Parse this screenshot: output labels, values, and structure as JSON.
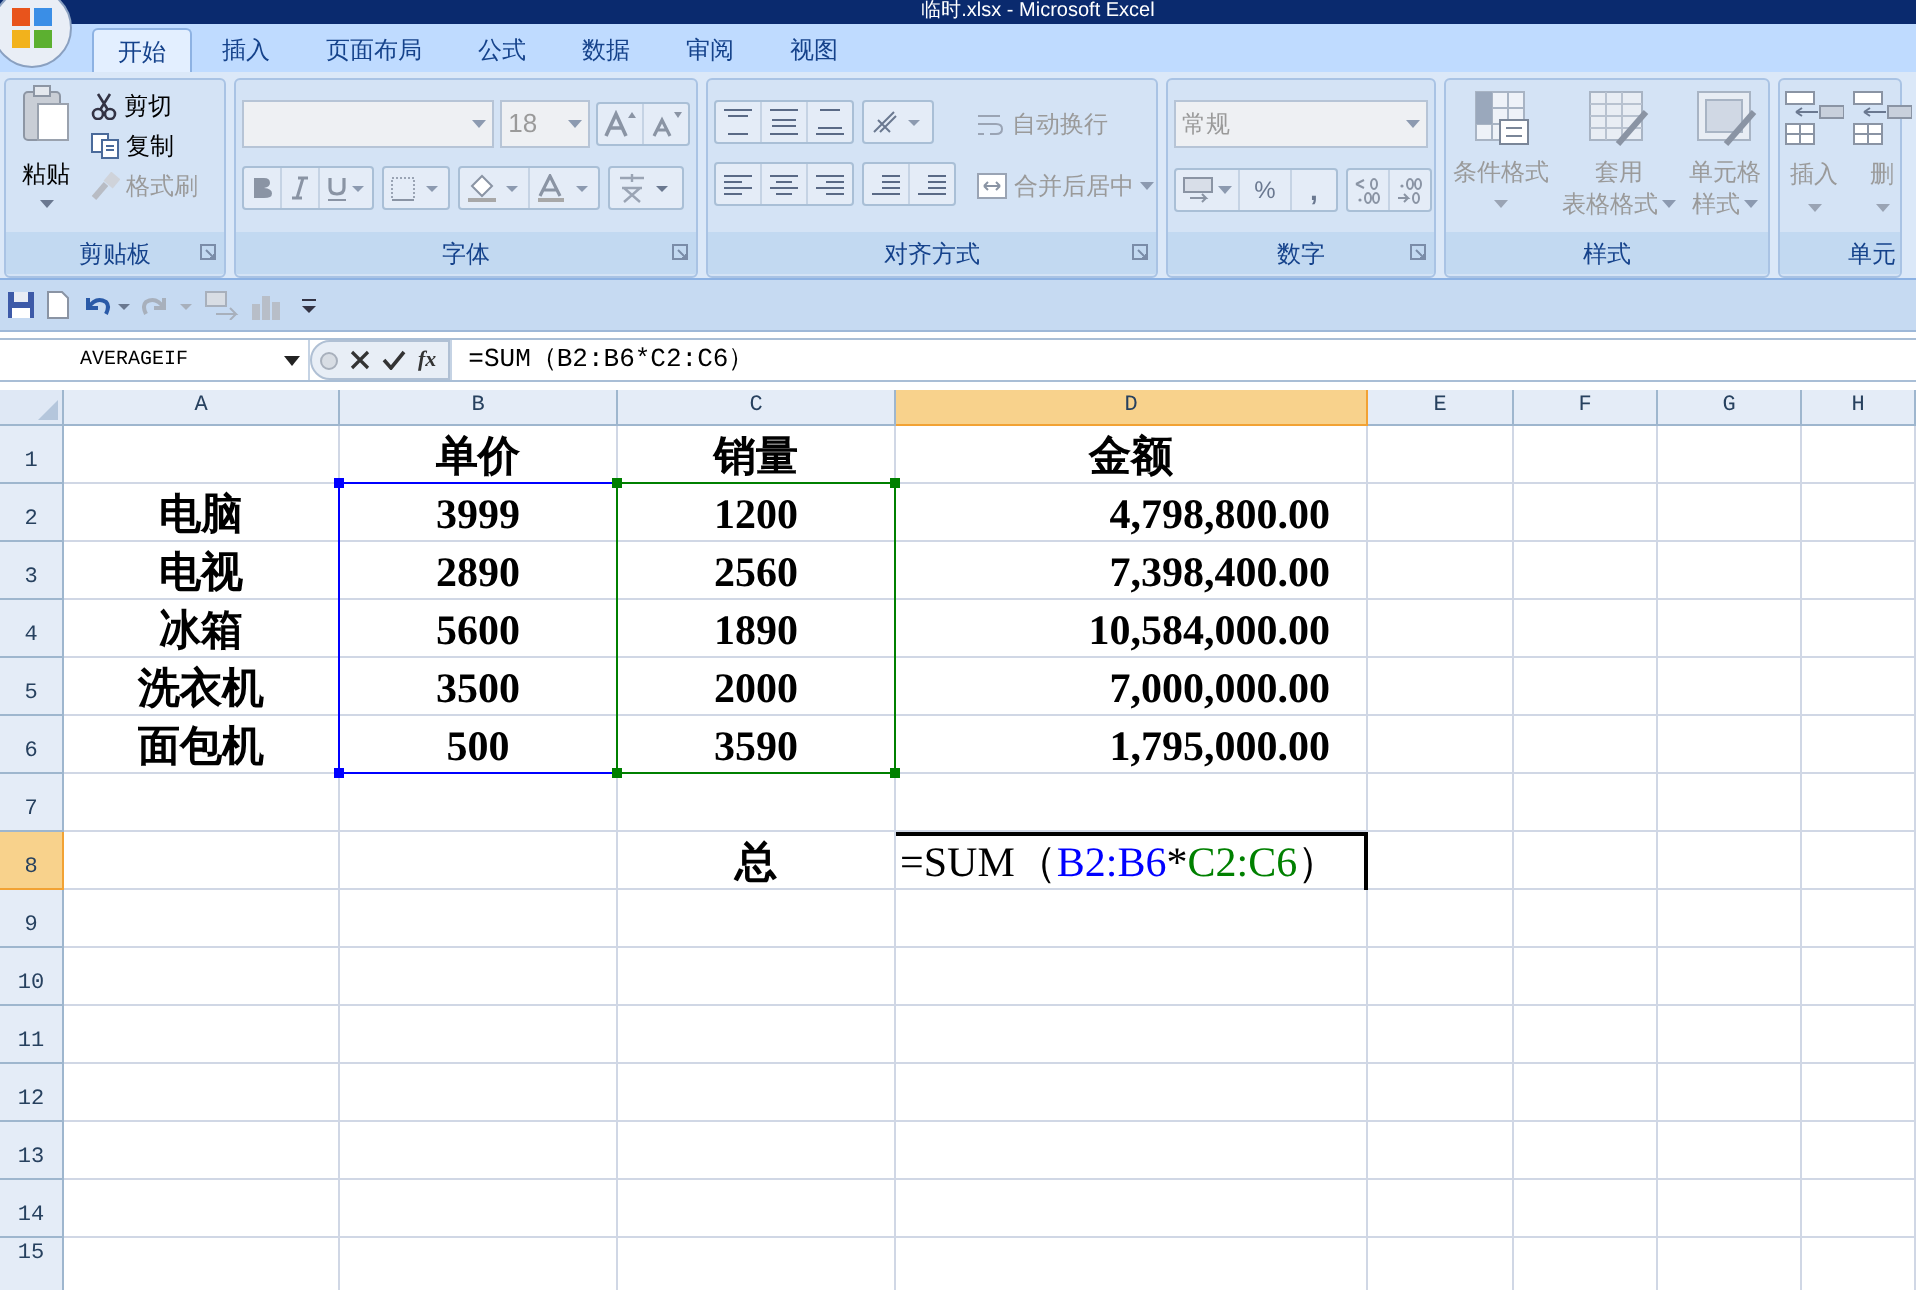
{
  "window": {
    "title": "临时.xlsx - Microsoft Excel"
  },
  "ribbon_tabs": [
    {
      "label": "开始",
      "selected": true
    },
    {
      "label": "插入",
      "selected": false
    },
    {
      "label": "页面布局",
      "selected": false
    },
    {
      "label": "公式",
      "selected": false
    },
    {
      "label": "数据",
      "selected": false
    },
    {
      "label": "审阅",
      "selected": false
    },
    {
      "label": "视图",
      "selected": false
    }
  ],
  "clipboard": {
    "label": "剪贴板",
    "paste": {
      "label": "粘贴",
      "disabled": false
    },
    "cut": {
      "label": "剪切",
      "disabled": false
    },
    "copy": {
      "label": "复制",
      "disabled": false
    },
    "format_painter": {
      "label": "格式刷",
      "disabled": true
    }
  },
  "font": {
    "label": "字体",
    "font_size": "18"
  },
  "alignment": {
    "label": "对齐方式",
    "wrap_text": {
      "label": "自动换行",
      "disabled": true
    },
    "merge_center": {
      "label": "合并后居中",
      "disabled": true
    }
  },
  "number": {
    "label": "数字",
    "format": "常规",
    "percent": "%",
    "comma": ","
  },
  "styles": {
    "label": "样式",
    "items": [
      {
        "lines": [
          "条件格式"
        ],
        "disabled": true
      },
      {
        "lines": [
          "套用",
          "表格格式"
        ],
        "disabled": true
      },
      {
        "lines": [
          "单元格",
          "样式"
        ],
        "disabled": true
      }
    ]
  },
  "cells": {
    "label": "单元",
    "items": [
      {
        "label": "插入",
        "disabled": true
      },
      {
        "label": "删",
        "disabled": true
      }
    ]
  },
  "formula_bar": {
    "name_box": "AVERAGEIF",
    "function_button": "fx",
    "formula": "=SUM（B2:B6*C2:C6）"
  },
  "columns": [
    {
      "label": "A",
      "selected": false
    },
    {
      "label": "B",
      "selected": false
    },
    {
      "label": "C",
      "selected": false
    },
    {
      "label": "D",
      "selected": true
    },
    {
      "label": "E",
      "selected": false
    },
    {
      "label": "F",
      "selected": false
    },
    {
      "label": "G",
      "selected": false
    },
    {
      "label": "H",
      "selected": false
    }
  ],
  "rows": [
    {
      "label": "1",
      "selected": false,
      "cells": [
        null,
        {
          "text": "单价"
        },
        {
          "text": "销量"
        },
        {
          "text": "金额"
        }
      ]
    },
    {
      "label": "2",
      "selected": false,
      "cells": [
        {
          "text": "电脑"
        },
        {
          "text": "3999",
          "color": "#0000ff"
        },
        {
          "text": "1200",
          "color": "#008000"
        },
        {
          "text": "4,798,800.00",
          "kind": "amount"
        }
      ]
    },
    {
      "label": "3",
      "selected": false,
      "cells": [
        {
          "text": "电视"
        },
        {
          "text": "2890",
          "color": "#0000ff"
        },
        {
          "text": "2560",
          "color": "#008000"
        },
        {
          "text": "7,398,400.00",
          "kind": "amount"
        }
      ]
    },
    {
      "label": "4",
      "selected": false,
      "cells": [
        {
          "text": "冰箱"
        },
        {
          "text": "5600",
          "color": "#0000ff"
        },
        {
          "text": "1890",
          "color": "#008000"
        },
        {
          "text": "10,584,000.00",
          "kind": "amount"
        }
      ]
    },
    {
      "label": "5",
      "selected": false,
      "cells": [
        {
          "text": "洗衣机"
        },
        {
          "text": "3500",
          "color": "#0000ff"
        },
        {
          "text": "2000",
          "color": "#008000"
        },
        {
          "text": "7,000,000.00",
          "kind": "amount"
        }
      ]
    },
    {
      "label": "6",
      "selected": false,
      "cells": [
        {
          "text": "面包机"
        },
        {
          "text": "500",
          "color": "#0000ff"
        },
        {
          "text": "3590",
          "color": "#008000"
        },
        {
          "text": "1,795,000.00",
          "kind": "amount"
        }
      ]
    },
    {
      "label": "7",
      "selected": false,
      "cells": []
    },
    {
      "label": "8",
      "selected": true,
      "cells": [
        null,
        null,
        {
          "text": "总"
        },
        {
          "kind": "formula",
          "active": true,
          "parts": [
            {
              "text": "=SUM（",
              "color": "#000000"
            },
            {
              "text": "B2:B6",
              "color": "#0000ff"
            },
            {
              "text": "*",
              "color": "#000000"
            },
            {
              "text": "C2:C6",
              "color": "#008000"
            },
            {
              "text": "）",
              "color": "#000000"
            }
          ]
        }
      ]
    },
    {
      "label": "9",
      "selected": false,
      "cells": []
    },
    {
      "label": "10",
      "selected": false,
      "cells": []
    },
    {
      "label": "11",
      "selected": false,
      "cells": []
    },
    {
      "label": "12",
      "selected": false,
      "cells": []
    },
    {
      "label": "13",
      "selected": false,
      "cells": []
    },
    {
      "label": "14",
      "selected": false,
      "cells": []
    },
    {
      "label": "15",
      "selected": false,
      "cells": []
    }
  ]
}
